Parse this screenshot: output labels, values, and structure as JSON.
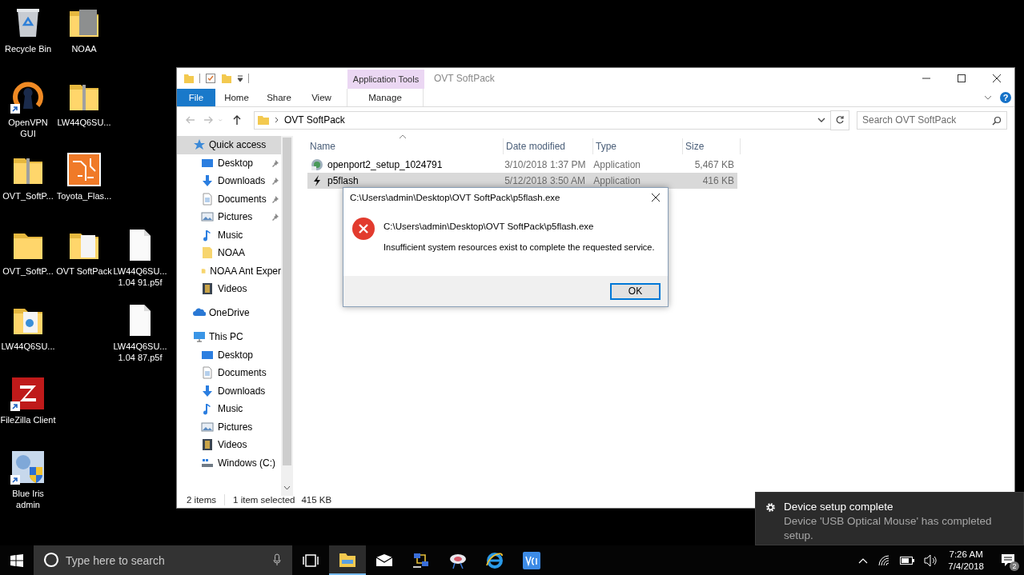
{
  "desktop_icons": [
    {
      "label": "Recycle Bin",
      "kind": "recycle",
      "shortcut": false
    },
    {
      "label": "NOAA",
      "kind": "folder-photo",
      "shortcut": false
    },
    {
      "label": "OpenVPN GUI",
      "kind": "openvpn",
      "shortcut": true
    },
    {
      "label": "LW44Q6SU...",
      "kind": "zip",
      "shortcut": false
    },
    {
      "label": "OVT_SoftP...",
      "kind": "zip",
      "shortcut": false
    },
    {
      "label": "Toyota_Flas...",
      "kind": "circuit",
      "shortcut": false
    },
    {
      "label": "OVT_SoftP...",
      "kind": "folder",
      "shortcut": false
    },
    {
      "label": "OVT SoftPack",
      "kind": "folder-doc",
      "shortcut": false
    },
    {
      "label": "LW44Q6SU... 1.04 91.p5f",
      "kind": "file",
      "shortcut": false
    },
    {
      "label": "LW44Q6SU...",
      "kind": "folder-app",
      "shortcut": false
    },
    {
      "label": "LW44Q6SU... 1.04 87.p5f",
      "kind": "file",
      "shortcut": false
    },
    {
      "label": "FileZilla Client",
      "kind": "filezilla",
      "shortcut": true
    },
    {
      "label": "Blue Iris admin",
      "kind": "blueiris",
      "shortcut": true
    }
  ],
  "explorer": {
    "title": "OVT SoftPack",
    "context_tab": "Application Tools",
    "ribbon_tabs": [
      {
        "label": "File",
        "kind": "file"
      },
      {
        "label": "Home",
        "kind": "tab"
      },
      {
        "label": "Share",
        "kind": "tab"
      },
      {
        "label": "View",
        "kind": "tab"
      },
      {
        "label": "Manage",
        "kind": "context"
      }
    ],
    "help_label": "?",
    "nav_buttons": [
      {
        "kind": "back",
        "disabled": true
      },
      {
        "kind": "forward",
        "disabled": true
      },
      {
        "kind": "recent",
        "disabled": true
      },
      {
        "kind": "up",
        "disabled": false
      }
    ],
    "path": [
      "OVT SoftPack"
    ],
    "search": {
      "placeholder": "Search OVT SoftPack"
    },
    "nav": [
      {
        "label": "Quick access",
        "kind": "star",
        "selected": true,
        "children": [
          {
            "label": "Desktop",
            "kind": "desktop",
            "pinned": true,
            "selected": false
          },
          {
            "label": "Downloads",
            "kind": "download",
            "pinned": true,
            "selected": false
          },
          {
            "label": "Documents",
            "kind": "document",
            "pinned": true,
            "selected": false
          },
          {
            "label": "Pictures",
            "kind": "picture",
            "pinned": true,
            "selected": false
          },
          {
            "label": "Music",
            "kind": "music",
            "pinned": false,
            "selected": false
          },
          {
            "label": "NOAA",
            "kind": "folder",
            "pinned": false,
            "selected": false
          },
          {
            "label": "NOAA Ant Exper",
            "kind": "folder",
            "pinned": false,
            "selected": false
          },
          {
            "label": "Videos",
            "kind": "video",
            "pinned": false,
            "selected": false
          }
        ]
      },
      {
        "label": "OneDrive",
        "kind": "cloud",
        "selected": false
      },
      {
        "label": "This PC",
        "kind": "pc",
        "selected": false,
        "children": [
          {
            "label": "Desktop",
            "kind": "desktop",
            "pinned": false,
            "selected": false
          },
          {
            "label": "Documents",
            "kind": "document",
            "pinned": false,
            "selected": false
          },
          {
            "label": "Downloads",
            "kind": "download",
            "pinned": false,
            "selected": false
          },
          {
            "label": "Music",
            "kind": "music",
            "pinned": false,
            "selected": false
          },
          {
            "label": "Pictures",
            "kind": "picture",
            "pinned": false,
            "selected": false
          },
          {
            "label": "Videos",
            "kind": "video",
            "pinned": false,
            "selected": false
          },
          {
            "label": "Windows (C:)",
            "kind": "drive",
            "pinned": false,
            "selected": false
          }
        ]
      }
    ],
    "columns": [
      "Name",
      "Date modified",
      "Type",
      "Size"
    ],
    "rows": [
      {
        "name": "openport2_setup_1024791",
        "date": "3/10/2018 1:37 PM",
        "type": "Application",
        "size": "5,467 KB",
        "kind": "installer",
        "selected": false
      },
      {
        "name": "p5flash",
        "date": "5/12/2018 3:50 AM",
        "type": "Application",
        "size": "416 KB",
        "kind": "flash",
        "selected": true
      }
    ],
    "status": {
      "count": "2 items",
      "selection": "1 item selected",
      "selection_size": "415 KB"
    }
  },
  "dialog": {
    "title": "C:\\Users\\admin\\Desktop\\OVT SoftPack\\p5flash.exe",
    "kind": "error",
    "path": "C:\\Users\\admin\\Desktop\\OVT SoftPack\\p5flash.exe",
    "message": "Insufficient system resources exist to complete the requested service.",
    "buttons": [
      {
        "label": "OK",
        "focused": true
      }
    ]
  },
  "toast": {
    "title": "Device setup complete",
    "body": "Device 'USB Optical Mouse' has completed setup."
  },
  "taskbar": {
    "search": {
      "placeholder": "Type here to search"
    },
    "apps": [
      {
        "kind": "taskview",
        "active": false
      },
      {
        "kind": "explorer",
        "active": true
      },
      {
        "kind": "mail",
        "active": false
      },
      {
        "kind": "network",
        "active": false
      },
      {
        "kind": "disk",
        "active": false
      },
      {
        "kind": "browser",
        "active": false
      },
      {
        "kind": "vnc",
        "active": false
      }
    ],
    "time": "7:26 AM",
    "date": "7/4/2018",
    "notification_count": "2"
  }
}
